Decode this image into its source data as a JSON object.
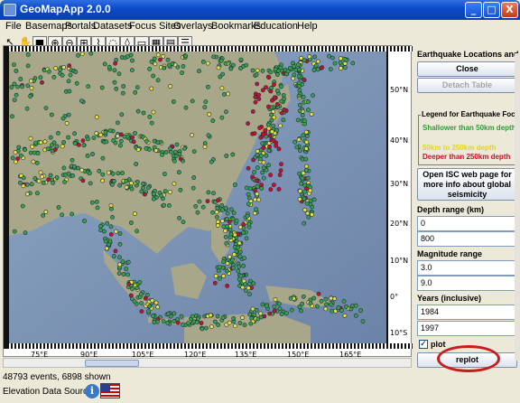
{
  "window": {
    "title": "GeoMapApp 2.0.0",
    "buttons": [
      "_",
      "□",
      "X"
    ]
  },
  "menu": {
    "items": [
      "File",
      "Basemaps",
      "Portals",
      "Datasets",
      "Focus Sites",
      "Overlays",
      "Bookmarks",
      "Education",
      "Help"
    ]
  },
  "toolbar": {
    "icons": [
      "arrow-icon",
      "hand-icon",
      "save-icon",
      "zoom-in-icon",
      "zoom-out-icon",
      "profile-icon",
      "digitize-icon",
      "lasso-icon",
      "image-icon",
      "grid-icon",
      "table-icon",
      "list-icon"
    ]
  },
  "map": {
    "lat_labels": [
      "50°N",
      "40°N",
      "30°N",
      "20°N",
      "10°N",
      "0°",
      "10°S"
    ],
    "lon_labels": [
      "75°E",
      "90°E",
      "105°E",
      "120°E",
      "135°E",
      "150°E",
      "165°E"
    ],
    "colors": {
      "ocean": "#7d93b4",
      "land": "#a9a78a",
      "shallow": "#37a04a",
      "intermediate": "#e8e23a",
      "deep": "#c8102e"
    }
  },
  "status": {
    "events": "48793 events, 6898 shown",
    "elevation": "Elevation Data Sources"
  },
  "panel": {
    "header": "Earthquake Locations and Ep...",
    "close_label": "Close",
    "detach_label": "Detach Table",
    "legend": {
      "title": "Legend for Earthquake Foci",
      "shallow": "Shallower than 50km depth",
      "intermediate": "50km to 250km depth",
      "deep": "Deeper than 250km depth"
    },
    "isc_label": "Open ISC web page for more info about global seismicity",
    "depth_label": "Depth range (km)",
    "depth_min": "0",
    "depth_max": "800",
    "mag_label": "Magnitude range",
    "mag_min": "3.0",
    "mag_max": "9.0",
    "years_label": "Years (inclusive)",
    "year_min": "1984",
    "year_max": "1997",
    "plot_label": "plot",
    "replot_label": "replot"
  }
}
